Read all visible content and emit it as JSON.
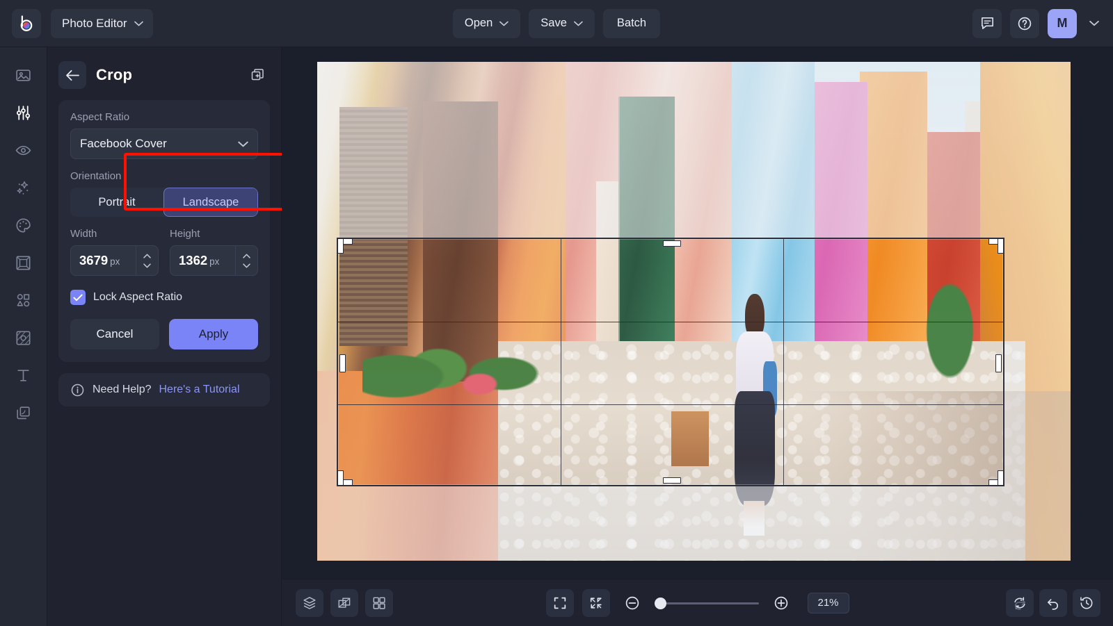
{
  "app": {
    "logo_name": "brand-logo",
    "menu_label": "Photo Editor"
  },
  "topbar": {
    "open_label": "Open",
    "save_label": "Save",
    "batch_label": "Batch",
    "feedback_icon": "comment-icon",
    "help_icon": "help-circle-icon",
    "avatar_initial": "M",
    "accent_color": "#7b84f7"
  },
  "rail": {
    "items": [
      {
        "icon": "image-icon",
        "name": "sidebar-item-image",
        "active": false
      },
      {
        "icon": "sliders-icon",
        "name": "sidebar-item-adjust",
        "active": true
      },
      {
        "icon": "eye-icon",
        "name": "sidebar-item-preview",
        "active": false
      },
      {
        "icon": "sparkles-icon",
        "name": "sidebar-item-effects",
        "active": false
      },
      {
        "icon": "palette-icon",
        "name": "sidebar-item-retouch",
        "active": false
      },
      {
        "icon": "frame-icon",
        "name": "sidebar-item-frame",
        "active": false
      },
      {
        "icon": "shapes-icon",
        "name": "sidebar-item-shapes",
        "active": false
      },
      {
        "icon": "texture-icon",
        "name": "sidebar-item-texture",
        "active": false
      },
      {
        "icon": "text-icon",
        "name": "sidebar-item-text",
        "active": false
      },
      {
        "icon": "layers-icon",
        "name": "sidebar-item-layers",
        "active": false
      }
    ]
  },
  "panel": {
    "back_icon": "arrow-left-icon",
    "title": "Crop",
    "duplicate_icon": "duplicate-add-icon",
    "aspect_ratio": {
      "label": "Aspect Ratio",
      "value": "Facebook Cover",
      "chevron_icon": "chevron-down-icon",
      "highlight_color": "#ff1100"
    },
    "orientation": {
      "label": "Orientation",
      "options": [
        "Portrait",
        "Landscape"
      ],
      "selected": "Landscape"
    },
    "width": {
      "label": "Width",
      "value": "3679",
      "unit": "px"
    },
    "height": {
      "label": "Height",
      "value": "1362",
      "unit": "px"
    },
    "lock": {
      "label": "Lock Aspect Ratio",
      "checked": true
    },
    "cancel_label": "Cancel",
    "apply_label": "Apply",
    "help": {
      "icon": "info-icon",
      "text": "Need Help?",
      "link": "Here's a Tutorial"
    }
  },
  "canvas": {
    "image_description": "Colorful Burano street with woman walking",
    "crop_overlay": "rule-of-thirds-grid"
  },
  "bottombar": {
    "layers_icon": "layers-stack-icon",
    "compare_icon": "compare-icon",
    "grid_icon": "grid-icon",
    "fit_icon": "fit-screen-icon",
    "shrink_icon": "shrink-icon",
    "zoom_out_icon": "zoom-out-icon",
    "zoom_in_icon": "zoom-in-icon",
    "zoom_value": "21%",
    "reset_icon": "reset-icon",
    "undo_icon": "undo-icon",
    "redo_icon": "redo-icon",
    "history_icon": "history-icon"
  }
}
